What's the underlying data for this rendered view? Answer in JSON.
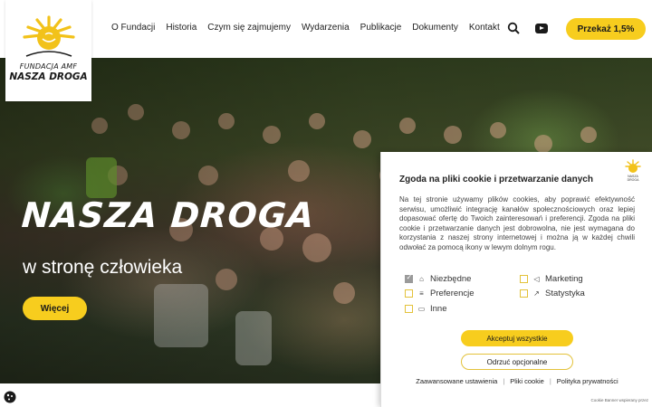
{
  "header": {
    "logo": {
      "line1": "FUNDACJA AMF",
      "line2": "NASZA DROGA"
    },
    "nav": [
      "O Fundacji",
      "Historia",
      "Czym się zajmujemy",
      "Wydarzenia",
      "Publikacje",
      "Dokumenty",
      "Kontakt"
    ],
    "donate_label": "Przekaż 1,5%",
    "icons": [
      "search-icon",
      "youtube-icon"
    ]
  },
  "hero": {
    "title": "NASZA DROGA",
    "subtitle": "w stronę człowieka",
    "button_label": "Więcej"
  },
  "cookie": {
    "title": "Zgoda na pliki cookie i przetwarzanie danych",
    "logo_text": "NASZA DROGA",
    "text": "Na tej stronie używamy plików cookies, aby poprawić efektywność serwisu, umożliwić integrację kanałów społecznościowych oraz lepiej dopasować ofertę do Twoich zainteresowań i preferencji. Zgoda na pliki cookie i przetwarzanie danych jest dobrowolna, nie jest wymagana do korzystania z naszej strony internetowej i można ją w każdej chwili odwołać za pomocą ikony w lewym dolnym rogu.",
    "options": [
      {
        "label": "Niezbędne",
        "checked": true,
        "icon": "home-icon"
      },
      {
        "label": "Marketing",
        "checked": false,
        "icon": "megaphone-icon"
      },
      {
        "label": "Preferencje",
        "checked": false,
        "icon": "sliders-icon"
      },
      {
        "label": "Statystyka",
        "checked": false,
        "icon": "chart-icon"
      },
      {
        "label": "Inne",
        "checked": false,
        "icon": "chat-icon"
      }
    ],
    "accept_label": "Akceptuj wszystkie",
    "reject_label": "Odrzuć opcjonalne",
    "links": [
      "Zaawansowane ustawienia",
      "Pliki cookie",
      "Polityka prywatności"
    ],
    "powered": "Cookie Banner wspierany przez"
  },
  "colors": {
    "accent": "#f7cd1e",
    "checkbox_border": "#e3c23a"
  }
}
